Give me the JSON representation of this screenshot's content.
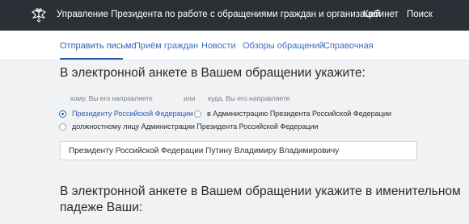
{
  "header": {
    "title": "Управление Президента по работе с обращениями граждан и организаций",
    "cabinet": "Кабинет",
    "search": "Поиск",
    "emblem_icon": "double-headed-eagle-emblem"
  },
  "nav": {
    "items": [
      {
        "label": "Отправить письмо",
        "active": true
      },
      {
        "label": "Приём граждан"
      },
      {
        "label": "Новости"
      },
      {
        "label": "Обзоры обращений"
      },
      {
        "label": "Справочная"
      }
    ]
  },
  "form": {
    "heading1": "В электронной анкете в Вашем обращении укажите:",
    "hint_to_whom": "кому, Вы его направляете",
    "hint_or": "или",
    "hint_where": "куда, Вы его направляете",
    "options": [
      {
        "label": "Президенту Российской Федерации",
        "checked": true
      },
      {
        "label": "в Администрацию Президента Российской Федерации",
        "checked": false
      },
      {
        "label": "должностному лицу Администрации Президента Российской Федерации",
        "checked": false
      }
    ],
    "addressee_value": "Президенту Российской Федерации Путину Владимиру Владимировичу",
    "heading2_line1": "В электронной анкете в Вашем обращении укажите в именительном",
    "heading2_line2": "падеже Ваши:"
  },
  "colors": {
    "topbar": "#2b2f36",
    "accent": "#2b5fb0",
    "background": "#f1f2f4"
  }
}
